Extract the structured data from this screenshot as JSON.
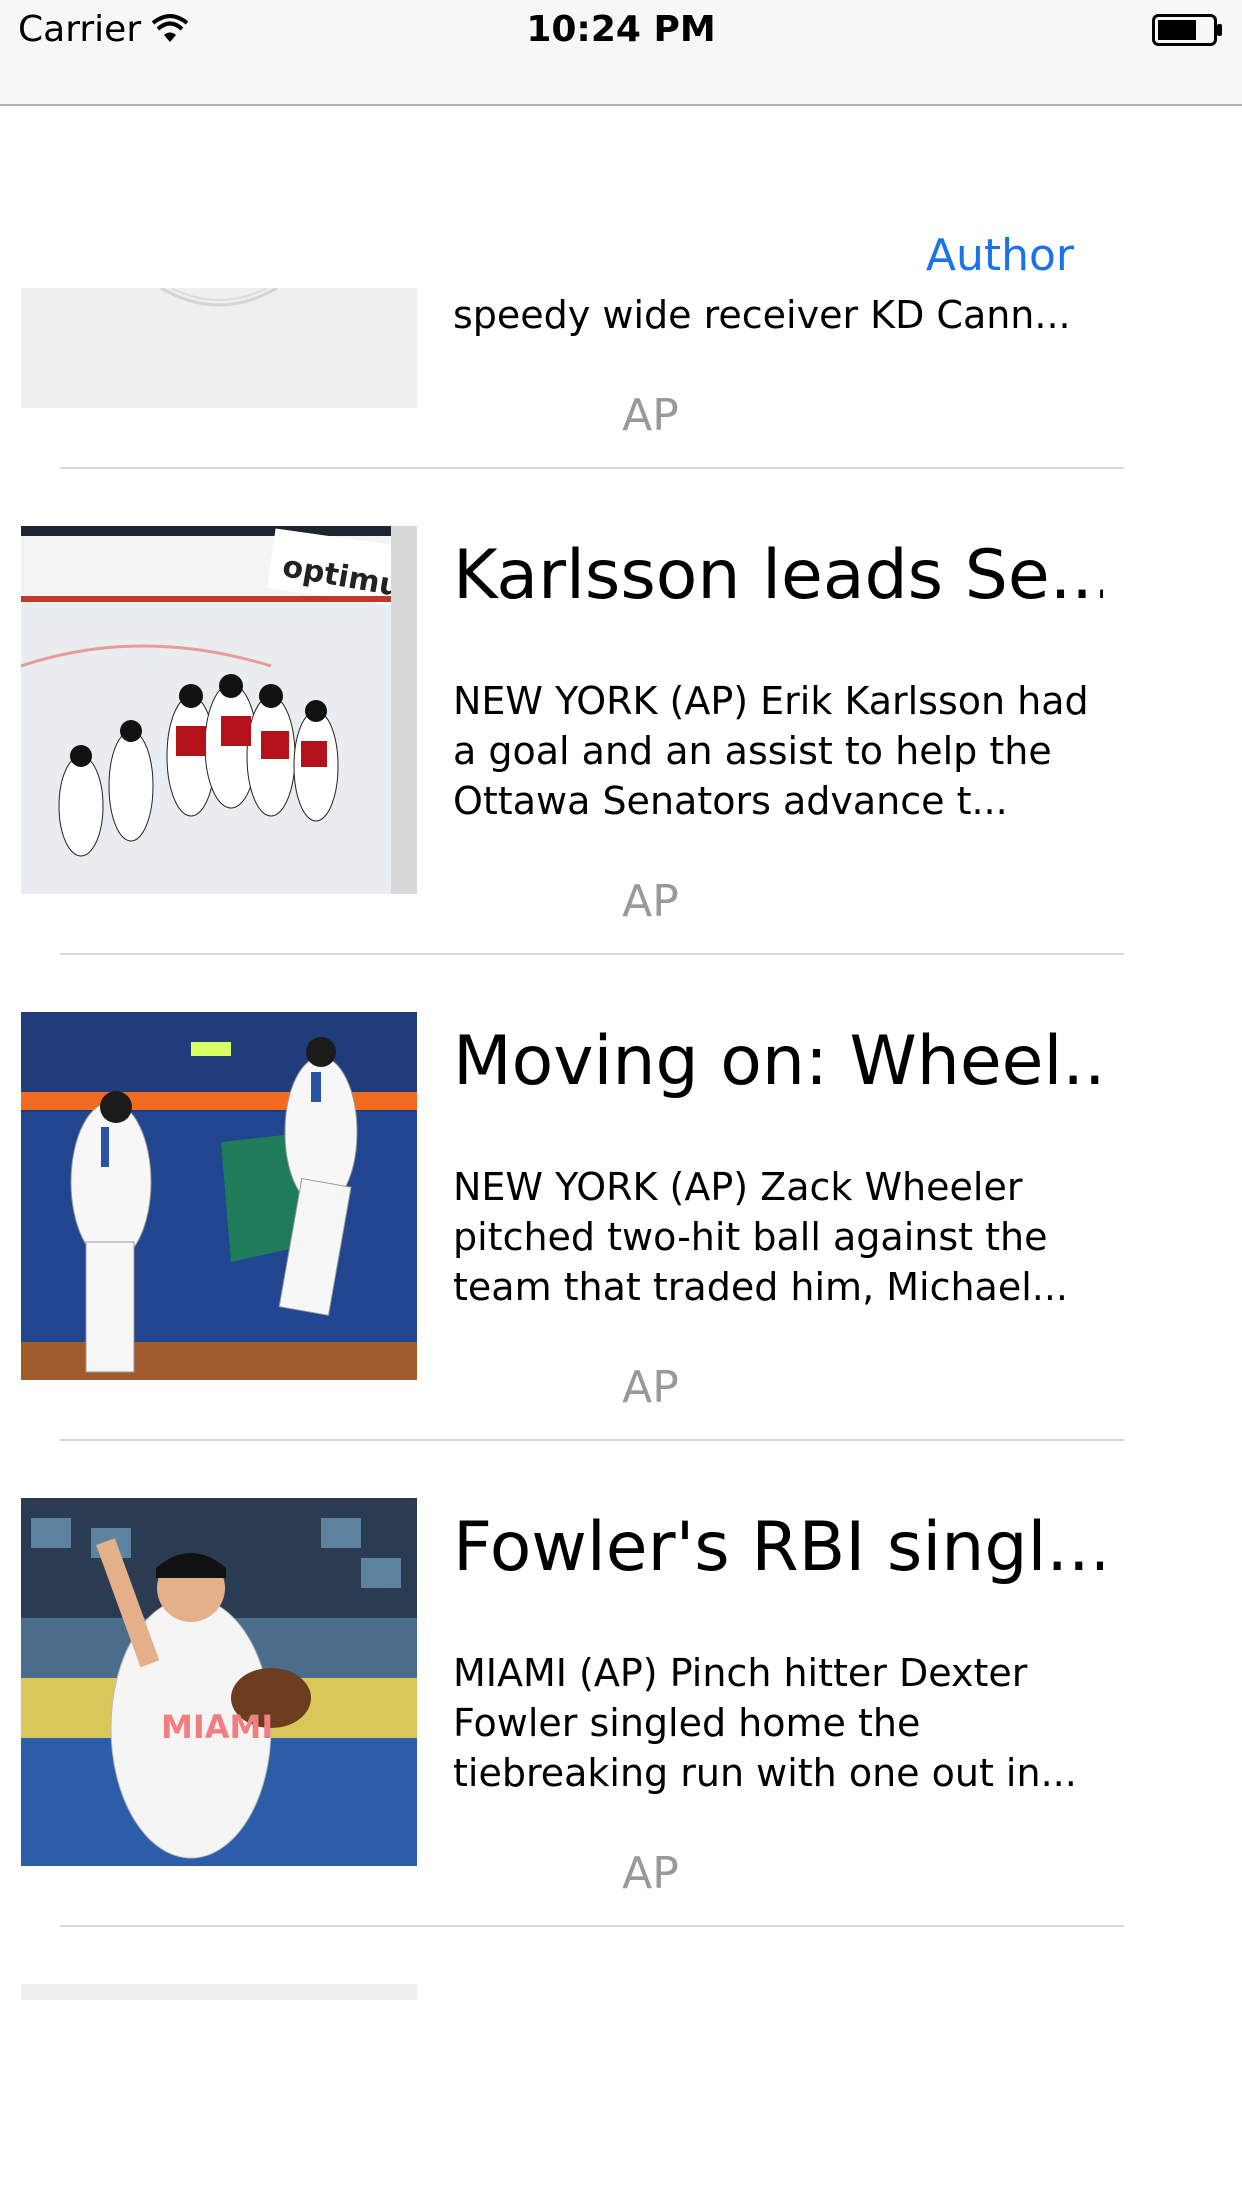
{
  "status_bar": {
    "carrier": "Carrier",
    "time": "10:24 PM",
    "wifi_icon": "wifi-icon",
    "battery_icon": "battery-icon"
  },
  "header": {
    "author_label": "Author"
  },
  "articles": [
    {
      "headline": "",
      "summary": "speedy wide receiver KD Cann...",
      "source": "AP",
      "image": "placeholder-image"
    },
    {
      "headline": "Karlsson leads Se...",
      "summary": "NEW YORK (AP)  Erik Karlsson had a goal and an assist to help the Ottawa Senators advance t...",
      "source": "AP",
      "image": "hockey-team-celebration-photo"
    },
    {
      "headline": "Moving on: Wheel...",
      "summary": "NEW YORK (AP)  Zack Wheeler pitched two-hit ball against the team that traded him, Michael...",
      "source": "AP",
      "image": "baseball-players-high-five-photo"
    },
    {
      "headline": "Fowler's RBI singl...",
      "summary": "MIAMI (AP)  Pinch hitter Dexter Fowler singled home the tiebreaking run with one out in...",
      "source": "AP",
      "image": "miami-pitcher-photo"
    }
  ],
  "colors": {
    "accent": "#1a73e8",
    "source_text": "#999999",
    "separator": "#d6d6d6",
    "status_bar_bg": "#f7f7f7"
  }
}
